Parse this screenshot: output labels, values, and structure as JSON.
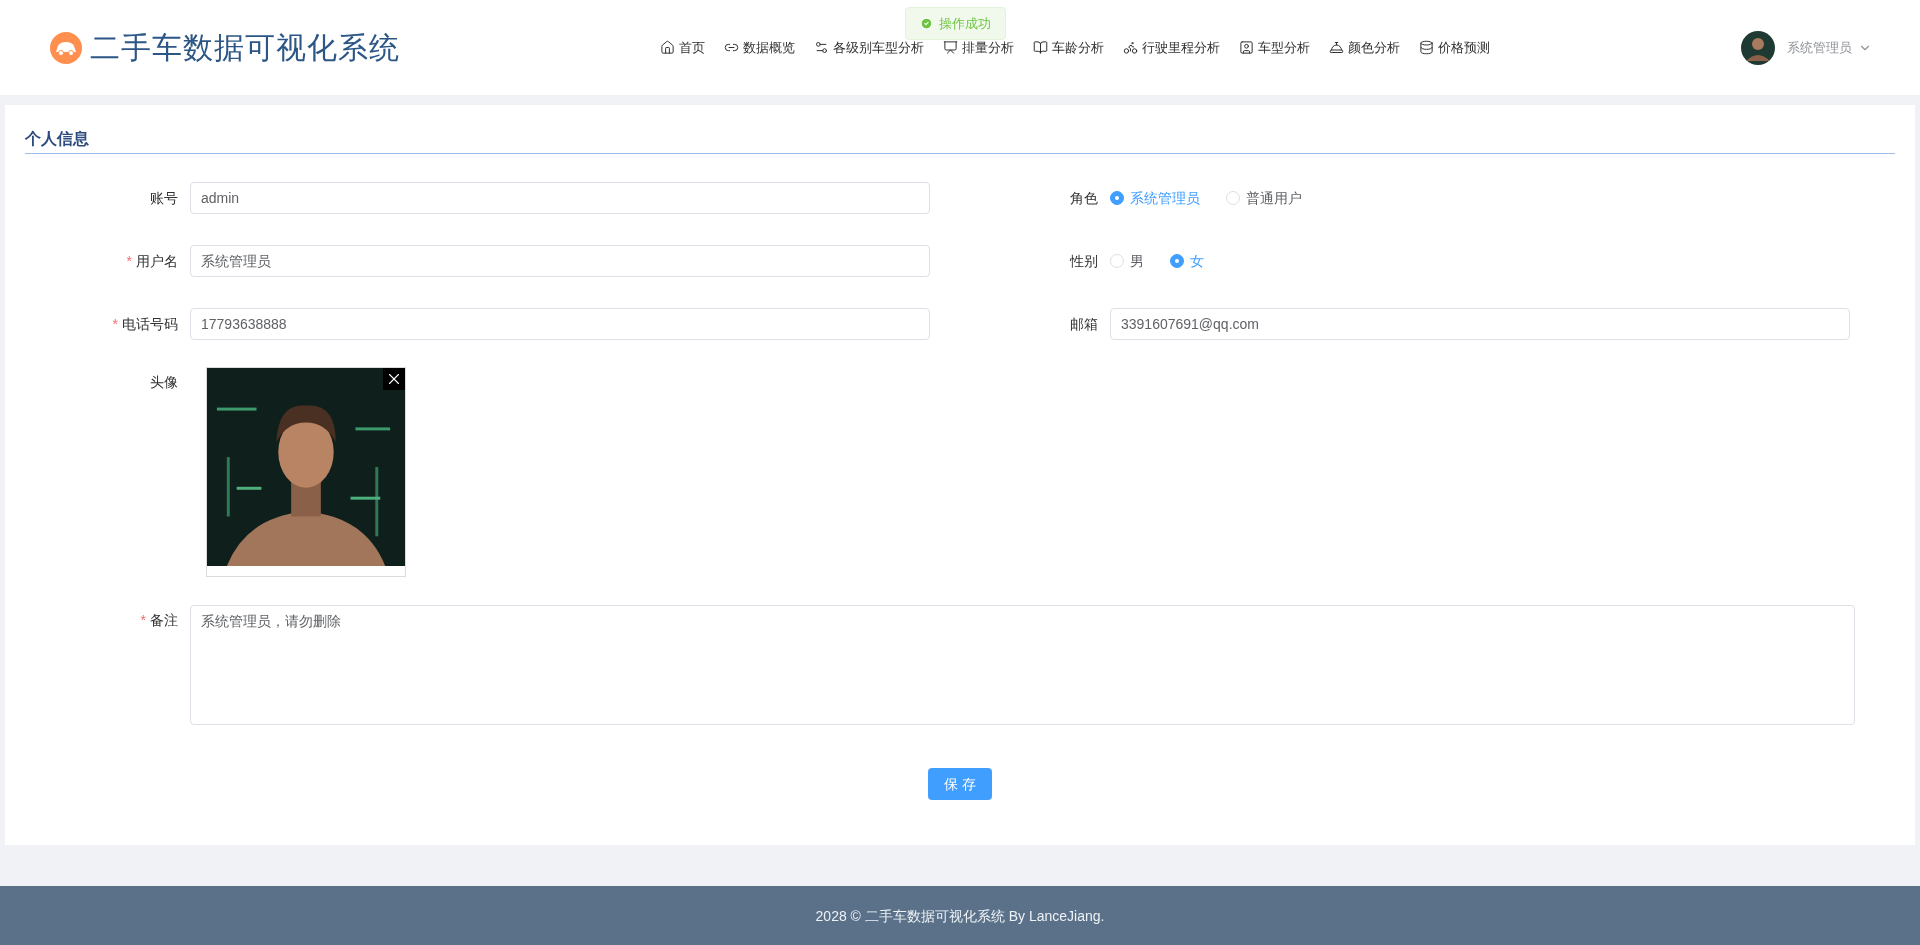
{
  "header": {
    "title": "二手车数据可视化系统",
    "nav": [
      {
        "label": "首页"
      },
      {
        "label": "数据概览"
      },
      {
        "label": "各级别车型分析"
      },
      {
        "label": "排量分析"
      },
      {
        "label": "车龄分析"
      },
      {
        "label": "行驶里程分析"
      },
      {
        "label": "车型分析"
      },
      {
        "label": "颜色分析"
      },
      {
        "label": "价格预测"
      }
    ],
    "user": {
      "name": "系统管理员"
    }
  },
  "toast": {
    "message": "操作成功"
  },
  "section": {
    "title": "个人信息"
  },
  "fields": [
    {
      "kind": "text",
      "label": "账号",
      "value": "admin"
    },
    {
      "kind": "radio",
      "label": "角色",
      "options": [
        {
          "label": "系统管理员",
          "selected": true
        },
        {
          "label": "普通用户",
          "selected": false
        }
      ]
    },
    {
      "kind": "text",
      "label": "用户名",
      "mark": "*",
      "value": "系统管理员"
    },
    {
      "kind": "radio",
      "label": "性别",
      "options": [
        {
          "label": "男",
          "selected": false
        },
        {
          "label": "女",
          "selected": true
        }
      ]
    },
    {
      "kind": "text",
      "label": "电话号码",
      "mark": "*",
      "value": "17793638888"
    },
    {
      "kind": "text",
      "label": "邮箱",
      "value": "3391607691@qq.com"
    },
    {
      "label": "头像"
    },
    {
      "kind": "textarea",
      "label": "备注",
      "mark": "*",
      "value": "系统管理员，请勿删除"
    }
  ],
  "save_button": "保 存",
  "footer": "2028 © 二手车数据可视化系统 By LanceJiang."
}
